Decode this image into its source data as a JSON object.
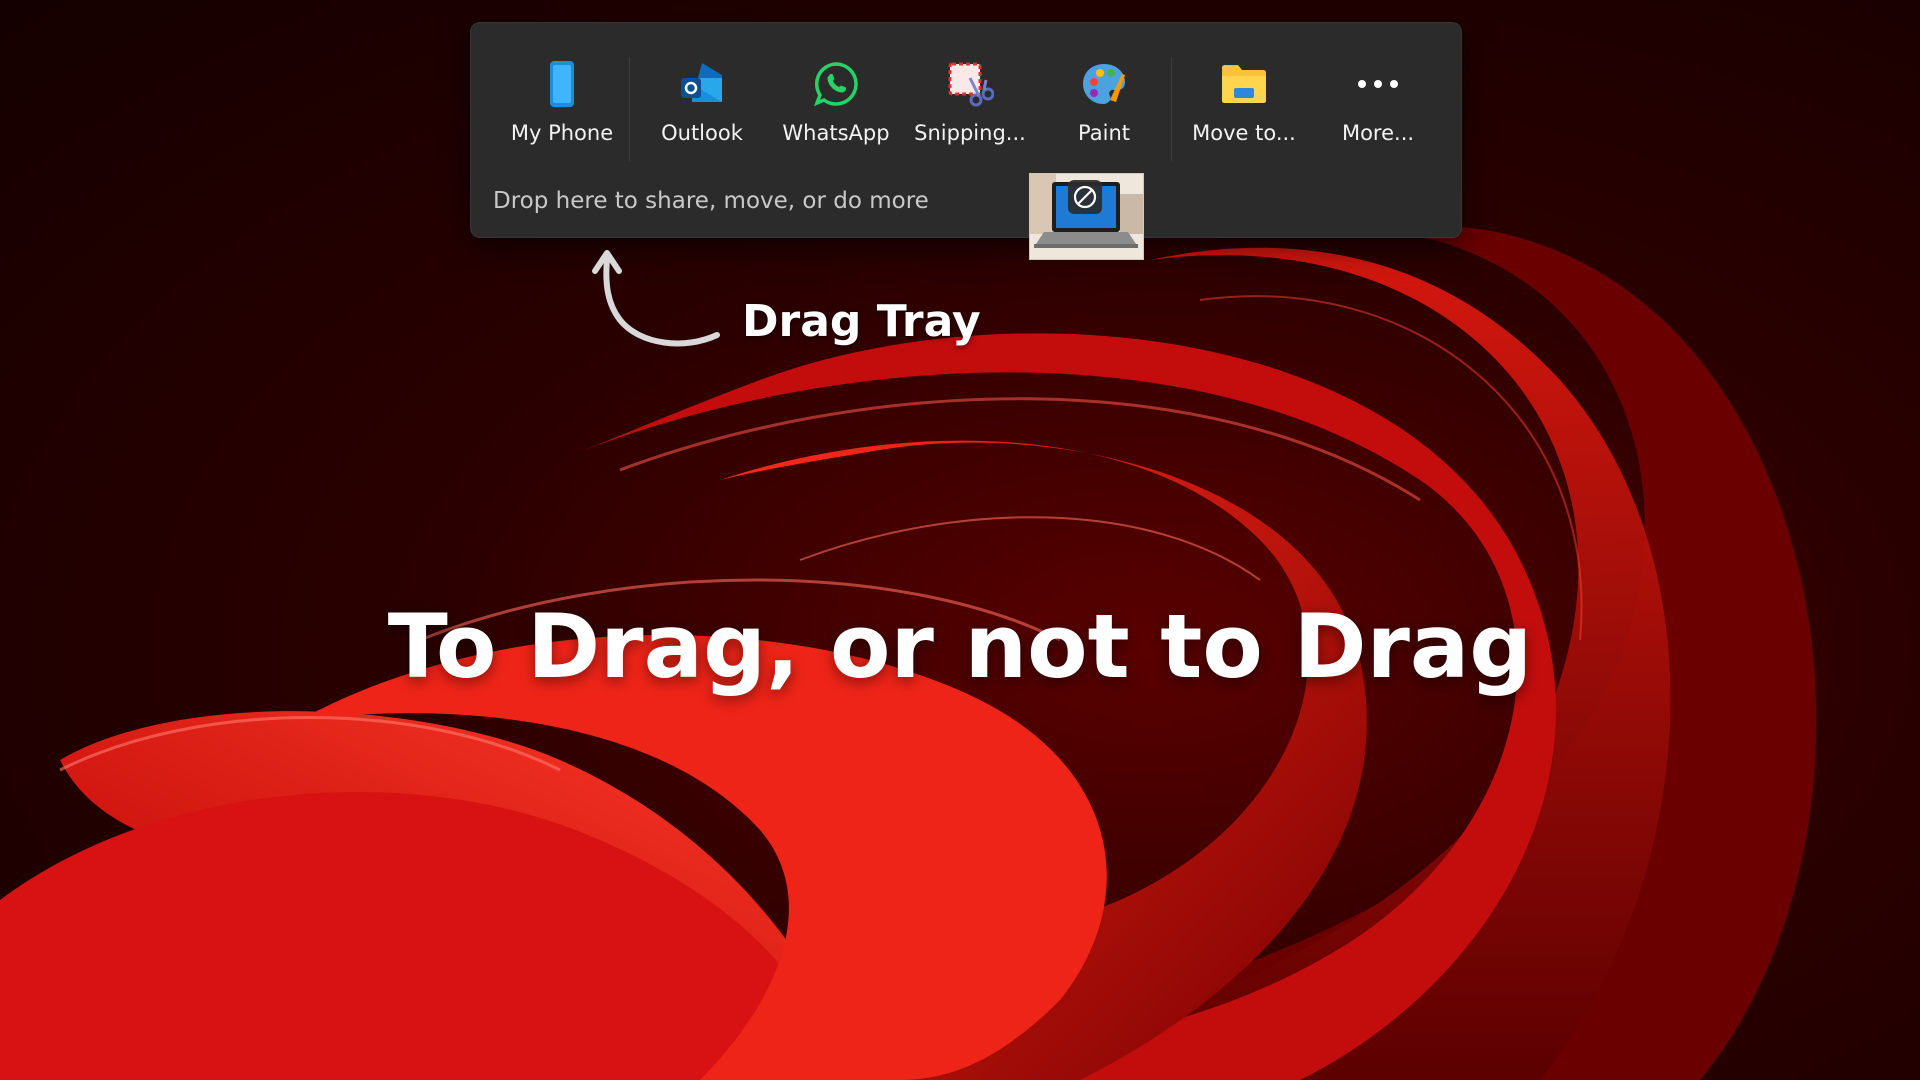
{
  "drag_tray": {
    "apps": [
      {
        "label": "My Phone",
        "icon": "phone-icon"
      },
      {
        "label": "Outlook",
        "icon": "outlook-icon"
      },
      {
        "label": "WhatsApp",
        "icon": "whatsapp-icon"
      },
      {
        "label": "Snipping...",
        "icon": "snipping-tool-icon"
      },
      {
        "label": "Paint",
        "icon": "paint-palette-icon"
      },
      {
        "label": "Move to...",
        "icon": "folder-icon"
      },
      {
        "label": "More...",
        "icon": "more-dots-icon"
      }
    ],
    "drop_hint": "Drop here to share, move, or do more",
    "dragged_item_icon": "no-drop-icon"
  },
  "annotation": {
    "label": "Drag Tray"
  },
  "headline": "To Drag, or not to Drag",
  "colors": {
    "tray_background": "#2b2b2b",
    "whatsapp": "#25d366",
    "outlook": "#0f6cbd",
    "folder": "#f8c23a",
    "wallpaper_red": "#e01010"
  }
}
